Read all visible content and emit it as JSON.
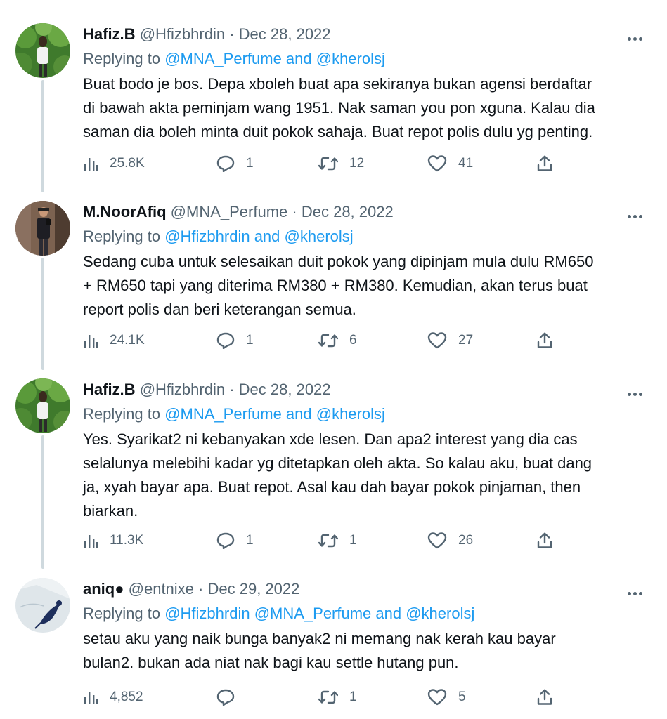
{
  "tweets": [
    {
      "name": "Hafiz.B",
      "handle": "@Hfizbhrdin",
      "date": "Dec 28, 2022",
      "replying_label": "Replying to",
      "replying_links": "@MNA_Perfume and @kherolsj",
      "body_lines": [
        "Buat bodo je bos. Depa xboleh buat apa sekiranya bukan agensi berdaftar",
        "di bawah akta peminjam wang 1951. Nak saman you pon xguna. Kalau dia",
        "saman dia boleh minta duit pokok sahaja. Buat repot polis dulu yg penting."
      ],
      "views": "25.8K",
      "replies": "1",
      "retweets": "12",
      "likes": "41",
      "avatar_icon": "person-standing-plants-photo"
    },
    {
      "name": "M.NoorAfiq",
      "handle": "@MNA_Perfume",
      "date": "Dec 28, 2022",
      "replying_label": "Replying to",
      "replying_links": "@Hfizbhrdin and @kherolsj",
      "body_lines": [
        "Sedang cuba untuk selesaikan duit pokok yang dipinjam mula dulu RM650",
        "+ RM650 tapi yang diterima RM380 + RM380. Kemudian, akan terus buat",
        "report polis dan beri keterangan semua."
      ],
      "views": "24.1K",
      "replies": "1",
      "retweets": "6",
      "likes": "27",
      "avatar_icon": "person-mirror-selfie-photo"
    },
    {
      "name": "Hafiz.B",
      "handle": "@Hfizbhrdin",
      "date": "Dec 28, 2022",
      "replying_label": "Replying to",
      "replying_links": "@MNA_Perfume and @kherolsj",
      "body_lines": [
        "Yes. Syarikat2 ni kebanyakan xde lesen. Dan apa2 interest yang dia cas",
        "selalunya melebihi kadar yg ditetapkan oleh akta. So kalau aku, buat dang",
        "ja, xyah bayar apa. Buat repot. Asal kau dah bayar pokok pinjaman, then",
        "biarkan."
      ],
      "views": "11.3K",
      "replies": "1",
      "retweets": "1",
      "likes": "26",
      "avatar_icon": "person-standing-plants-photo"
    },
    {
      "name": "aniq●",
      "handle": "@entnixe",
      "date": "Dec 29, 2022",
      "replying_label": "Replying to",
      "replying_links": "@Hfizbhrdin @MNA_Perfume and @kherolsj",
      "body_lines": [
        "setau aku yang naik bunga banyak2 ni memang nak kerah kau bayar",
        "bulan2. bukan ada niat nak bagi kau settle hutang pun."
      ],
      "views": "4,852",
      "replies": "",
      "retweets": "1",
      "likes": "5",
      "avatar_icon": "bird-drawing-photo"
    }
  ],
  "separator": "·",
  "colors": {
    "text": "#0f1419",
    "muted": "#536471",
    "link": "#1d9bf0",
    "thread_line": "#cfd9de"
  },
  "icons": [
    "views-icon",
    "reply-icon",
    "retweet-icon",
    "like-icon",
    "share-icon",
    "more-icon"
  ]
}
